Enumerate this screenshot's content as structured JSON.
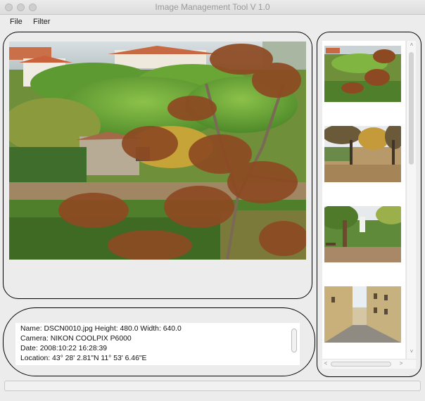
{
  "window": {
    "title": "Image Management Tool V 1.0",
    "controls": [
      "close-dot",
      "minimize-dot",
      "zoom-dot"
    ]
  },
  "menu": {
    "file": "File",
    "filter": "Filter"
  },
  "main_image": {
    "description_icon": "photo-tuscan-hillside"
  },
  "info": {
    "line1": "Name: DSCN0010.jpg  Height: 480.0  Width: 640.0",
    "line2": "Camera: NIKON COOLPIX P6000",
    "line3": "Date: 2008:10:22 16:28:39",
    "line4": "Location: 43° 28' 2.81\"N  11° 53' 6.46\"E"
  },
  "thumbnails": [
    "thumb-hillside",
    "thumb-avenue-trees",
    "thumb-park-monument",
    "thumb-narrow-street"
  ],
  "scroll": {
    "up": "˄",
    "down": "˅",
    "left": "˂",
    "right": "˃"
  },
  "colors": {
    "window_bg": "#ececec",
    "panel_border": "#000000",
    "list_bg": "#ffffff"
  }
}
